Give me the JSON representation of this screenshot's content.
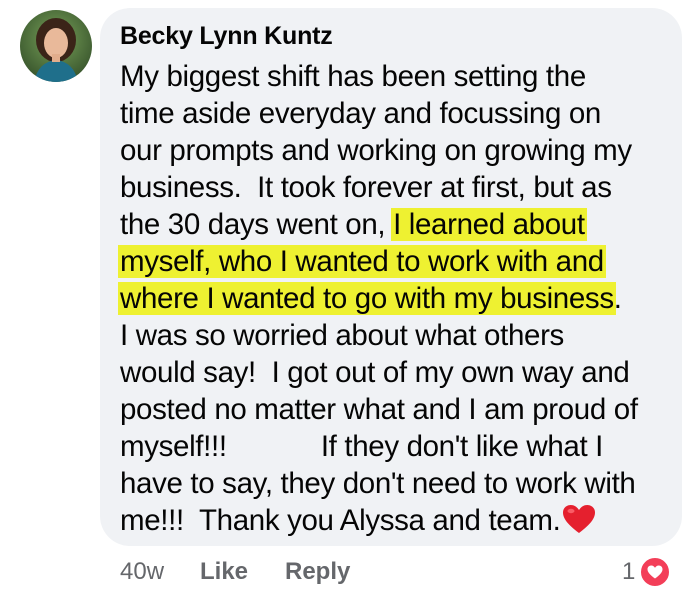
{
  "comment": {
    "author": "Becky Lynn Kuntz",
    "lines": [
      {
        "text": "My biggest shift has been setting the"
      },
      {
        "text": "time aside everyday and focussing on"
      },
      {
        "text": "our prompts and working on growing my"
      },
      {
        "text": "business.  It took forever at first, but as"
      },
      {
        "pre": "the 30 days went on, ",
        "highlight": "I learned about"
      },
      {
        "highlight": "myself, who I wanted to work with and"
      },
      {
        "highlight": "where I wanted to go with my business",
        "post": "."
      },
      {
        "text": "I was so worried about what others"
      },
      {
        "text": "would say!  I got out of my own way and"
      },
      {
        "text": "posted no matter what and I am proud of"
      },
      {
        "text": "myself!!!            If they don't like what I"
      },
      {
        "text": "have to say, they don't need to work with"
      },
      {
        "text": "me!!!  Thank you Alyssa and team."
      }
    ],
    "emoji": "heart-emoji"
  },
  "actions": {
    "time": "40w",
    "like": "Like",
    "reply": "Reply"
  },
  "reactions": {
    "count": "1",
    "icon": "love-reaction-icon",
    "color": "#f33e58"
  },
  "colors": {
    "bubble": "#f0f2f5",
    "highlight": "#eef131",
    "text": "#050505",
    "muted": "#65676b"
  }
}
